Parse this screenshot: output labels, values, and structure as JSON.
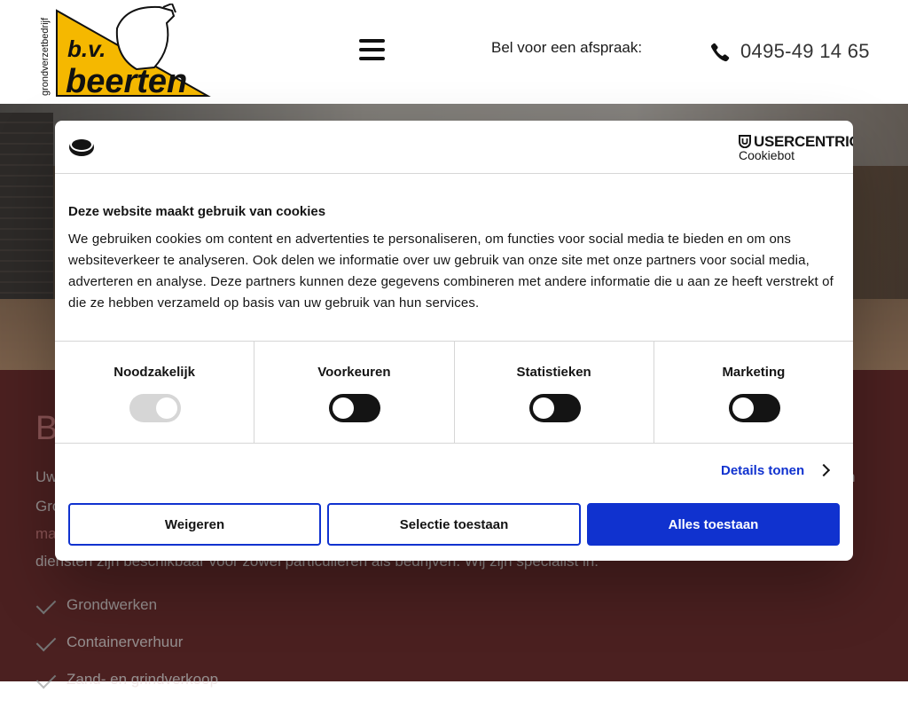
{
  "header": {
    "logo_top": "grondverzetbedrijf",
    "logo_brand_small": "b.v.",
    "logo_brand": "beerten",
    "call_text": "Bel voor een afspraak:",
    "phone": "0495-49 14 65"
  },
  "content": {
    "title_initial": "B",
    "paragraph_lines": [
      "Uw",
      "Gro",
      "ma",
      "diensten zijn beschikbaar voor zowel particulieren als bedrijven. Wij zijn specialist in:"
    ],
    "paragraph_right": "n",
    "checklist": [
      "Grondwerken",
      "Containerverhuur",
      "Zand- en grindverkoop"
    ]
  },
  "cookie": {
    "brand": "USERCENTRICS",
    "brand_sub": "Cookiebot",
    "title": "Deze website maakt gebruik van cookies",
    "body": "We gebruiken cookies om content en advertenties te personaliseren, om functies voor social media te bieden en om ons websiteverkeer te analyseren. Ook delen we informatie over uw gebruik van onze site met onze partners voor social media, adverteren en analyse. Deze partners kunnen deze gegevens combineren met andere informatie die u aan ze heeft verstrekt of die ze hebben verzameld op basis van uw gebruik van hun services.",
    "categories": [
      {
        "label": "Noodzakelijk",
        "enabled": true,
        "locked": true
      },
      {
        "label": "Voorkeuren",
        "enabled": false
      },
      {
        "label": "Statistieken",
        "enabled": false
      },
      {
        "label": "Marketing",
        "enabled": false
      }
    ],
    "details_label": "Details tonen",
    "buttons": {
      "reject": "Weigeren",
      "selection": "Selectie toestaan",
      "accept_all": "Alles toestaan"
    },
    "colors": {
      "accent": "#1032cf",
      "toggle_off": "#141414",
      "toggle_locked": "#d6d6d6"
    }
  },
  "colors": {
    "section_bg": "#7a3434",
    "title_accent": "#e0888a",
    "logo_yellow": "#f5b800"
  }
}
